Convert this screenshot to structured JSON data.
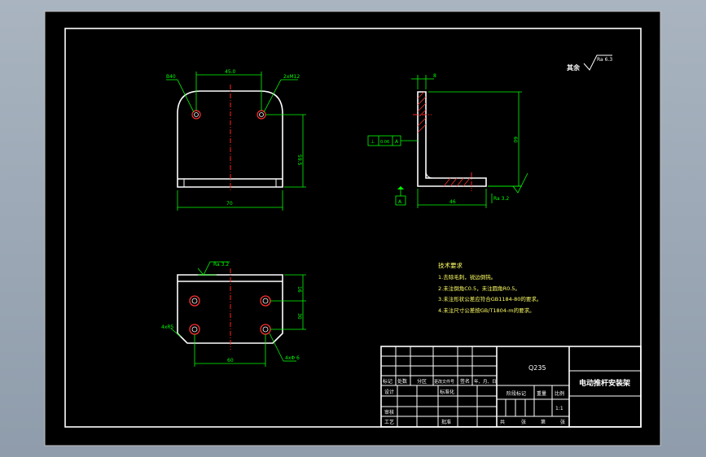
{
  "drawing": {
    "surface_roughness": "Ra 6.3",
    "surface_prefix": "其余",
    "front_view": {
      "dim_top": "45.0",
      "dim_right": "59.5",
      "dim_bottom": "70",
      "label_left": "B40",
      "label_right": "2xM12"
    },
    "side_view": {
      "dim_top": "8",
      "dim_right": "60",
      "dim_bottom": "46",
      "tolerance_sym": "⊥",
      "tolerance_val": "0.06",
      "tolerance_ref": "A",
      "datum": "A",
      "roughness_small": "Ra 3.2"
    },
    "bottom_view": {
      "roughness": "Ra 3.2",
      "dim_right1": "16",
      "dim_right2": "30",
      "dim_bottom": "60",
      "label_left": "4xR5",
      "label_right": "4xΦ 6"
    },
    "notes": {
      "title": "技术要求",
      "items": [
        "1.去除毛刺，锐边倒钝。",
        "2.未注倒角C0.5，未注圆角R0.5。",
        "3.未注形状公差应符合GB1184-80的要求。",
        "4.未注尺寸公差按GB/T1804-m的要求。"
      ]
    },
    "title_block": {
      "material": "Q235",
      "part_name": "电动推杆安装架",
      "row_headers": [
        "标记",
        "处数",
        "分区",
        "更改文件号",
        "签名",
        "年、月、日"
      ],
      "designer": "设计",
      "standardization": "标准化",
      "checker": "审核",
      "process": "工艺",
      "approve": "批准",
      "stage_mark": "阶段标记",
      "weight": "重量",
      "scale": "比例",
      "scale_value": "1:1",
      "sheet_total": "共",
      "sheet_total_unit": "张",
      "sheet_no": "第",
      "sheet_no_unit": "张"
    }
  }
}
